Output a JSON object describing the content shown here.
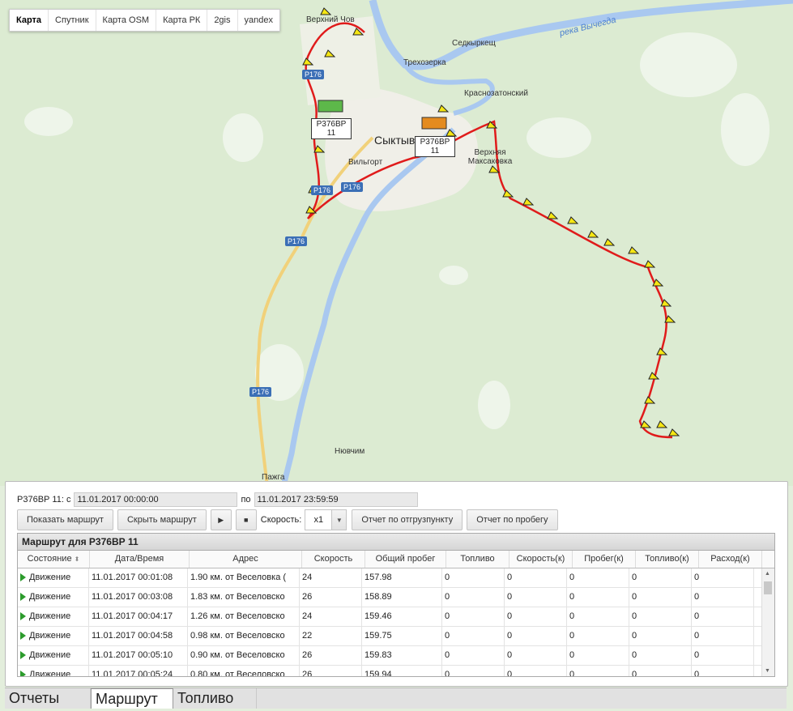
{
  "map_tabs": [
    "Карта",
    "Спутник",
    "Карта OSM",
    "Карта РК",
    "2gis",
    "yandex"
  ],
  "map": {
    "places": [
      "Верхний Чов",
      "Седкыркещ",
      "Трехозерка",
      "Краснозатонский",
      "Сыктыв",
      "Вильгорт",
      "Верхняя Максаковка",
      "Нювчим",
      "Пажга"
    ],
    "roads": [
      "Р176",
      "Р176",
      "Р176",
      "Р176",
      "Р176"
    ],
    "river": "река Вычегда",
    "vehicle_label_1": "Р376ВР 11",
    "vehicle_label_2": "Р376ВР 11",
    "route_color": "#e01b1b"
  },
  "filter": {
    "vehicle_prefix": "Р376ВР 11: с",
    "from_value": "11.01.2017 00:00:00",
    "to_label": "по",
    "to_value": "11.01.2017 23:59:59"
  },
  "buttons": {
    "show_route": "Показать маршрут",
    "hide_route": "Скрыть маршрут",
    "play": "▶",
    "stop": "■",
    "speed_label": "Скорость:",
    "speed_value": "x1",
    "report_unload": "Отчет по отгрузпункту",
    "report_mileage": "Отчет по пробегу"
  },
  "grid": {
    "title": "Маршрут для Р376ВР 11",
    "columns": [
      "Состояние",
      "Дата/Время",
      "Адрес",
      "Скорость",
      "Общий пробег",
      "Топливо",
      "Скорость(к)",
      "Пробег(к)",
      "Топливо(к)",
      "Расход(к)"
    ],
    "rows": [
      [
        "Движение",
        "11.01.2017 00:01:08",
        "1.90 км. от Веселовка (",
        "24",
        "157.98",
        "0",
        "0",
        "0",
        "0",
        "0"
      ],
      [
        "Движение",
        "11.01.2017 00:03:08",
        "1.83 км. от Веселовско",
        "26",
        "158.89",
        "0",
        "0",
        "0",
        "0",
        "0"
      ],
      [
        "Движение",
        "11.01.2017 00:04:17",
        "1.26 км. от Веселовско",
        "24",
        "159.46",
        "0",
        "0",
        "0",
        "0",
        "0"
      ],
      [
        "Движение",
        "11.01.2017 00:04:58",
        "0.98 км. от Веселовско",
        "22",
        "159.75",
        "0",
        "0",
        "0",
        "0",
        "0"
      ],
      [
        "Движение",
        "11.01.2017 00:05:10",
        "0.90 км. от Веселовско",
        "26",
        "159.83",
        "0",
        "0",
        "0",
        "0",
        "0"
      ],
      [
        "Движение",
        "11.01.2017 00:05:24",
        "0.80 км. от Веселовско",
        "26",
        "159.94",
        "0",
        "0",
        "0",
        "0",
        "0"
      ]
    ]
  },
  "bottom_tabs": [
    "Отчеты",
    "Маршрут",
    "Топливо"
  ]
}
